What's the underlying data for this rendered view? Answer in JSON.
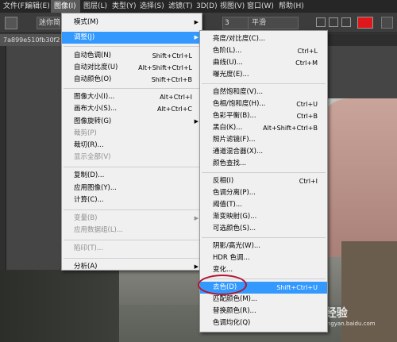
{
  "menubar": {
    "items": [
      {
        "label": "文件(F)"
      },
      {
        "label": "编辑(E)"
      },
      {
        "label": "图像(I)"
      },
      {
        "label": "图层(L)"
      },
      {
        "label": "类型(Y)"
      },
      {
        "label": "选择(S)"
      },
      {
        "label": "滤镜(T)"
      },
      {
        "label": "3D(D)"
      },
      {
        "label": "视图(V)"
      },
      {
        "label": "窗口(W)"
      },
      {
        "label": "帮助(H)"
      }
    ]
  },
  "options": {
    "style_value": "迷你简",
    "size_value": "3",
    "antialias_value": "平滑",
    "text_color": "#e0171a"
  },
  "doc": {
    "tab_label": "7a899e510fb30f2"
  },
  "image_menu": {
    "items": [
      {
        "label": "模式(M)",
        "shortcut": "",
        "submenu": true,
        "disabled": false
      },
      {
        "label": "调整(J)",
        "shortcut": "",
        "submenu": true,
        "disabled": false,
        "highlighted": true
      },
      {
        "label": "自动色调(N)",
        "shortcut": "Shift+Ctrl+L",
        "disabled": false
      },
      {
        "label": "自动对比度(U)",
        "shortcut": "Alt+Shift+Ctrl+L",
        "disabled": false
      },
      {
        "label": "自动颜色(O)",
        "shortcut": "Shift+Ctrl+B",
        "disabled": false
      },
      {
        "label": "图像大小(I)...",
        "shortcut": "Alt+Ctrl+I",
        "disabled": false
      },
      {
        "label": "画布大小(S)...",
        "shortcut": "Alt+Ctrl+C",
        "disabled": false
      },
      {
        "label": "图像旋转(G)",
        "shortcut": "",
        "submenu": true,
        "disabled": false
      },
      {
        "label": "裁剪(P)",
        "shortcut": "",
        "disabled": true
      },
      {
        "label": "裁切(R)...",
        "shortcut": "",
        "disabled": false
      },
      {
        "label": "显示全部(V)",
        "shortcut": "",
        "disabled": true
      },
      {
        "label": "复制(D)...",
        "shortcut": "",
        "disabled": false
      },
      {
        "label": "应用图像(Y)...",
        "shortcut": "",
        "disabled": false
      },
      {
        "label": "计算(C)...",
        "shortcut": "",
        "disabled": false
      },
      {
        "label": "变量(B)",
        "shortcut": "",
        "submenu": true,
        "disabled": true
      },
      {
        "label": "应用数据组(L)...",
        "shortcut": "",
        "disabled": true
      },
      {
        "label": "陷印(T)...",
        "shortcut": "",
        "disabled": true
      },
      {
        "label": "分析(A)",
        "shortcut": "",
        "submenu": true,
        "disabled": false
      }
    ]
  },
  "adjust_menu": {
    "items": [
      {
        "label": "亮度/对比度(C)...",
        "shortcut": ""
      },
      {
        "label": "色阶(L)...",
        "shortcut": "Ctrl+L"
      },
      {
        "label": "曲线(U)...",
        "shortcut": "Ctrl+M"
      },
      {
        "label": "曝光度(E)...",
        "shortcut": ""
      },
      {
        "label": "自然饱和度(V)...",
        "shortcut": ""
      },
      {
        "label": "色相/饱和度(H)...",
        "shortcut": "Ctrl+U"
      },
      {
        "label": "色彩平衡(B)...",
        "shortcut": "Ctrl+B"
      },
      {
        "label": "黑白(K)...",
        "shortcut": "Alt+Shift+Ctrl+B"
      },
      {
        "label": "照片滤镜(F)...",
        "shortcut": ""
      },
      {
        "label": "通道混合器(X)...",
        "shortcut": ""
      },
      {
        "label": "颜色查找...",
        "shortcut": ""
      },
      {
        "label": "反相(I)",
        "shortcut": "Ctrl+I"
      },
      {
        "label": "色调分离(P)...",
        "shortcut": ""
      },
      {
        "label": "阈值(T)...",
        "shortcut": ""
      },
      {
        "label": "渐变映射(G)...",
        "shortcut": ""
      },
      {
        "label": "可选颜色(S)...",
        "shortcut": ""
      },
      {
        "label": "阴影/高光(W)...",
        "shortcut": ""
      },
      {
        "label": "HDR 色调...",
        "shortcut": ""
      },
      {
        "label": "变化...",
        "shortcut": ""
      },
      {
        "label": "去色(D)",
        "shortcut": "Shift+Ctrl+U",
        "highlighted": true
      },
      {
        "label": "匹配颜色(M)...",
        "shortcut": ""
      },
      {
        "label": "替换颜色(R)...",
        "shortcut": ""
      },
      {
        "label": "色调均化(Q)",
        "shortcut": ""
      }
    ]
  },
  "watermark": {
    "text": "Bai 经验",
    "url": "jingyan.baidu.com"
  }
}
